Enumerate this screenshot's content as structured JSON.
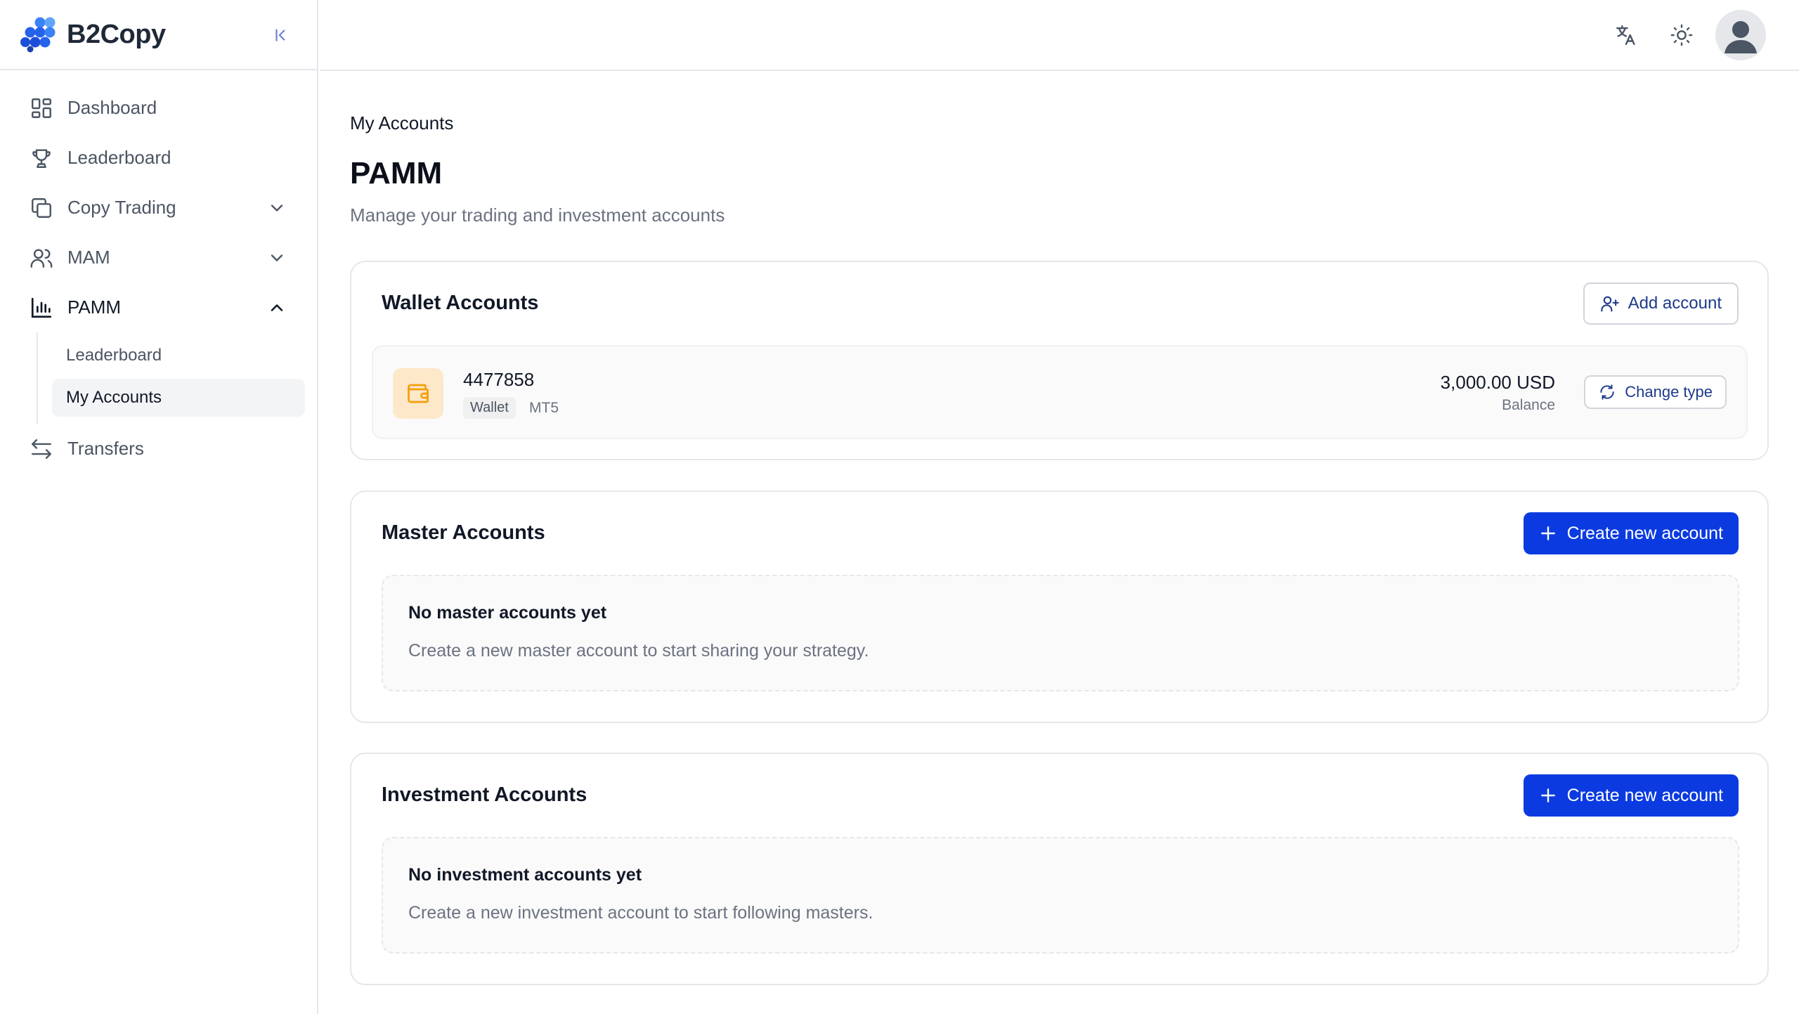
{
  "app": {
    "name": "B2Copy"
  },
  "sidebar": {
    "items": [
      {
        "label": "Dashboard"
      },
      {
        "label": "Leaderboard"
      },
      {
        "label": "Copy Trading"
      },
      {
        "label": "MAM"
      },
      {
        "label": "PAMM"
      },
      {
        "label": "Transfers"
      }
    ],
    "pamm_sub": [
      {
        "label": "Leaderboard"
      },
      {
        "label": "My Accounts"
      }
    ]
  },
  "header": {
    "breadcrumb": "My Accounts",
    "title": "PAMM",
    "subtitle": "Manage your trading and investment accounts"
  },
  "wallet": {
    "title": "Wallet Accounts",
    "add_label": "Add account",
    "account": {
      "number": "4477858",
      "type_tag": "Wallet",
      "platform": "MT5",
      "amount": "3,000.00 USD",
      "amount_label": "Balance",
      "change_label": "Change type"
    }
  },
  "master": {
    "title": "Master Accounts",
    "create_label": "Create new account",
    "empty_title": "No master accounts yet",
    "empty_desc": "Create a new master account to start sharing your strategy."
  },
  "investment": {
    "title": "Investment Accounts",
    "create_label": "Create new account",
    "empty_title": "No investment accounts yet",
    "empty_desc": "Create a new investment account to start following masters."
  },
  "colors": {
    "accent": "#0b3be0",
    "wallet_tile": "#fde8c9",
    "wallet_icon": "#f59e0b",
    "logo": "#2563eb"
  }
}
